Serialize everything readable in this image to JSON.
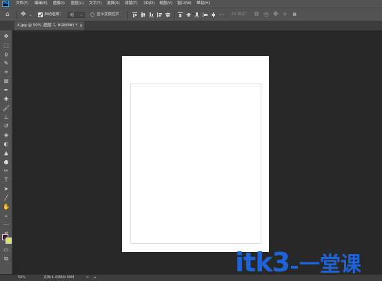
{
  "app": {
    "logo_text": "Ps"
  },
  "menu": [
    "文件(F)",
    "编辑(E)",
    "图像(I)",
    "图层(L)",
    "文字(Y)",
    "选择(S)",
    "滤镜(T)",
    "3D(D)",
    "视图(V)",
    "窗口(W)",
    "帮助(H)"
  ],
  "options_bar": {
    "auto_select_label": "自动选择：",
    "auto_select_checked": true,
    "auto_select_target": "组",
    "show_transform_label": "显示变换控件",
    "show_transform_checked": false,
    "mode_3d_label": "3D 模式："
  },
  "document_tab": {
    "label": "4.jpg @ 50% (图层 1, RGB/8#) *",
    "close": "×"
  },
  "tools": [
    "move-tool",
    "marquee-tool",
    "lasso-tool",
    "quick-select-tool",
    "crop-tool",
    "frame-tool",
    "eyedropper-tool",
    "healing-brush-tool",
    "brush-tool",
    "clone-stamp-tool",
    "history-brush-tool",
    "eraser-tool",
    "paint-bucket-tool",
    "blur-tool",
    "dodge-tool",
    "pen-tool",
    "type-tool",
    "path-select-tool",
    "line-tool",
    "hand-tool",
    "zoom-tool",
    "more-tools"
  ],
  "colors": {
    "foreground": "#3a1428",
    "background": "#d7e84c",
    "watermark": "#1e63d8"
  },
  "status_bar": {
    "zoom": "50%",
    "doc_info": "文档:4.43M/8.09M",
    "arrow": ">"
  },
  "watermark": {
    "latin": "itk3",
    "chinese": "一堂课"
  }
}
